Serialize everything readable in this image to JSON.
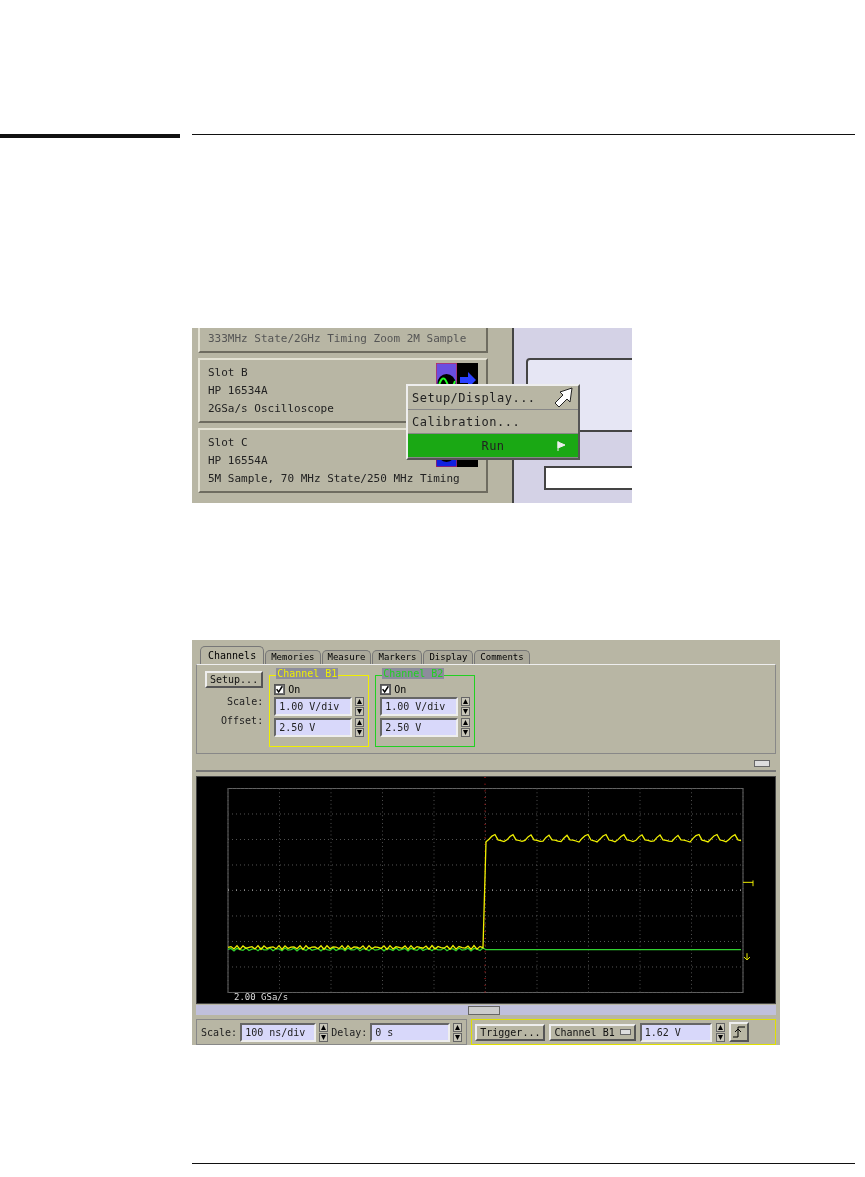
{
  "system_view": {
    "slots": [
      {
        "lines": [
          "333MHz State/2GHz Timing Zoom 2M Sample"
        ],
        "kind": "partial"
      },
      {
        "lines": [
          "Slot B",
          "HP 16534A",
          "2GSa/s Oscilloscope"
        ],
        "kind": "scope"
      },
      {
        "lines": [
          "Slot C",
          "HP 16554A",
          "5M Sample, 70 MHz State/250 MHz Timing"
        ],
        "kind": "analyzer"
      }
    ],
    "module_menu": [
      {
        "label": "Setup/Display...",
        "selected": false,
        "kind": "item"
      },
      {
        "label": "Calibration...",
        "selected": false,
        "kind": "item"
      },
      {
        "label": "Run",
        "selected": true,
        "kind": "run"
      }
    ]
  },
  "scope_window": {
    "tabs": [
      {
        "label": "Channels",
        "selected": true
      },
      {
        "label": "Memories",
        "selected": false
      },
      {
        "label": "Measure",
        "selected": false
      },
      {
        "label": "Markers",
        "selected": false
      },
      {
        "label": "Display",
        "selected": false
      },
      {
        "label": "Comments",
        "selected": false
      }
    ],
    "setup_button": "Setup...",
    "scale_label": "Scale:",
    "offset_label": "Offset:",
    "channels": [
      {
        "title": "Channel B1",
        "color": "#f0f000",
        "on_label": "On",
        "on": true,
        "scale": "1.00 V/div",
        "offset": "2.50 V"
      },
      {
        "title": "Channel B2",
        "color": "#22d022",
        "on_label": "On",
        "on": true,
        "scale": "1.00 V/div",
        "offset": "2.50 V"
      }
    ],
    "sample_rate": "2.00 GSa/s",
    "timebase": {
      "scale_label": "Scale:",
      "scale": "100 ns/div",
      "delay_label": "Delay:",
      "delay": "0 s"
    },
    "trigger": {
      "button": "Trigger...",
      "source": "Channel B1",
      "level": "1.62 V"
    }
  }
}
